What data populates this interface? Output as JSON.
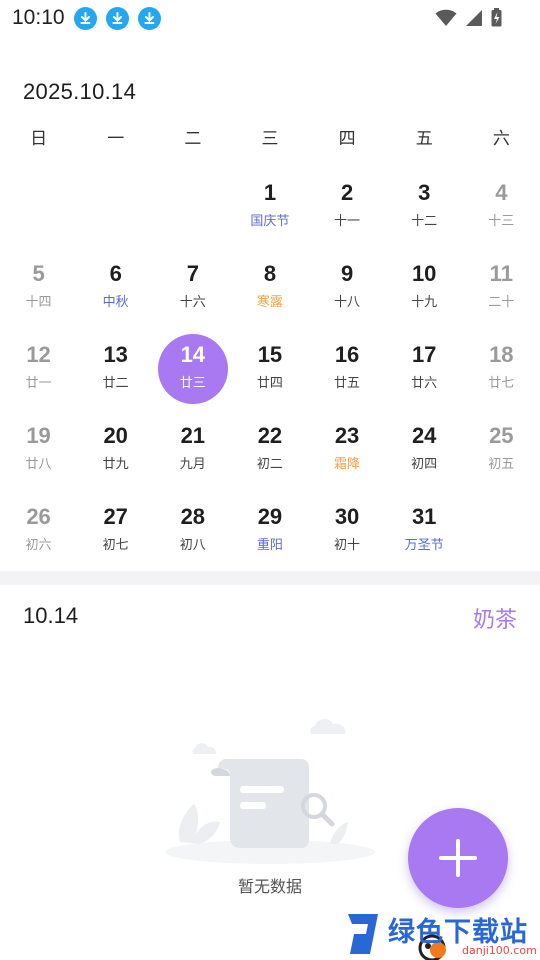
{
  "status_bar": {
    "time": "10:10",
    "download_icons": [
      "download-icon",
      "download-icon",
      "download-icon"
    ],
    "system_icons": [
      "wifi-icon",
      "signal-icon",
      "battery-charging-icon"
    ]
  },
  "calendar": {
    "title": "2025.10.14",
    "weekdays": [
      "日",
      "一",
      "二",
      "三",
      "四",
      "五",
      "六"
    ],
    "rows": [
      [
        {
          "d": "",
          "s": ""
        },
        {
          "d": "",
          "s": ""
        },
        {
          "d": "",
          "s": ""
        },
        {
          "d": "1",
          "s": "国庆节",
          "t": "fest"
        },
        {
          "d": "2",
          "s": "十一"
        },
        {
          "d": "3",
          "s": "十二"
        },
        {
          "d": "4",
          "s": "十三",
          "w": true
        }
      ],
      [
        {
          "d": "5",
          "s": "十四",
          "w": true
        },
        {
          "d": "6",
          "s": "中秋",
          "t": "fest"
        },
        {
          "d": "7",
          "s": "十六"
        },
        {
          "d": "8",
          "s": "寒露",
          "t": "term"
        },
        {
          "d": "9",
          "s": "十八"
        },
        {
          "d": "10",
          "s": "十九"
        },
        {
          "d": "11",
          "s": "二十",
          "w": true
        }
      ],
      [
        {
          "d": "12",
          "s": "廿一",
          "w": true
        },
        {
          "d": "13",
          "s": "廿二"
        },
        {
          "d": "14",
          "s": "廿三",
          "sel": true
        },
        {
          "d": "15",
          "s": "廿四"
        },
        {
          "d": "16",
          "s": "廿五"
        },
        {
          "d": "17",
          "s": "廿六"
        },
        {
          "d": "18",
          "s": "廿七",
          "w": true
        }
      ],
      [
        {
          "d": "19",
          "s": "廿八",
          "w": true
        },
        {
          "d": "20",
          "s": "廿九"
        },
        {
          "d": "21",
          "s": "九月"
        },
        {
          "d": "22",
          "s": "初二"
        },
        {
          "d": "23",
          "s": "霜降",
          "t": "term"
        },
        {
          "d": "24",
          "s": "初四"
        },
        {
          "d": "25",
          "s": "初五",
          "w": true
        }
      ],
      [
        {
          "d": "26",
          "s": "初六",
          "w": true
        },
        {
          "d": "27",
          "s": "初七"
        },
        {
          "d": "28",
          "s": "初八"
        },
        {
          "d": "29",
          "s": "重阳",
          "t": "fest"
        },
        {
          "d": "30",
          "s": "初十"
        },
        {
          "d": "31",
          "s": "万圣节",
          "t": "fest"
        },
        {
          "d": "",
          "s": ""
        }
      ]
    ]
  },
  "details": {
    "date": "10.14",
    "tag": "奶茶",
    "empty_text": "暂无数据"
  },
  "fab": {
    "icon": "plus-icon"
  },
  "watermark": {
    "text": "绿色下载站",
    "url": "danji100.com",
    "logo": "watermark-logo-icon"
  },
  "colors": {
    "accent": "#a879f1",
    "festival": "#5b6bd3",
    "solar_term": "#f0a14a",
    "weekend": "#9a9a9a",
    "download": "#22a7f0"
  }
}
